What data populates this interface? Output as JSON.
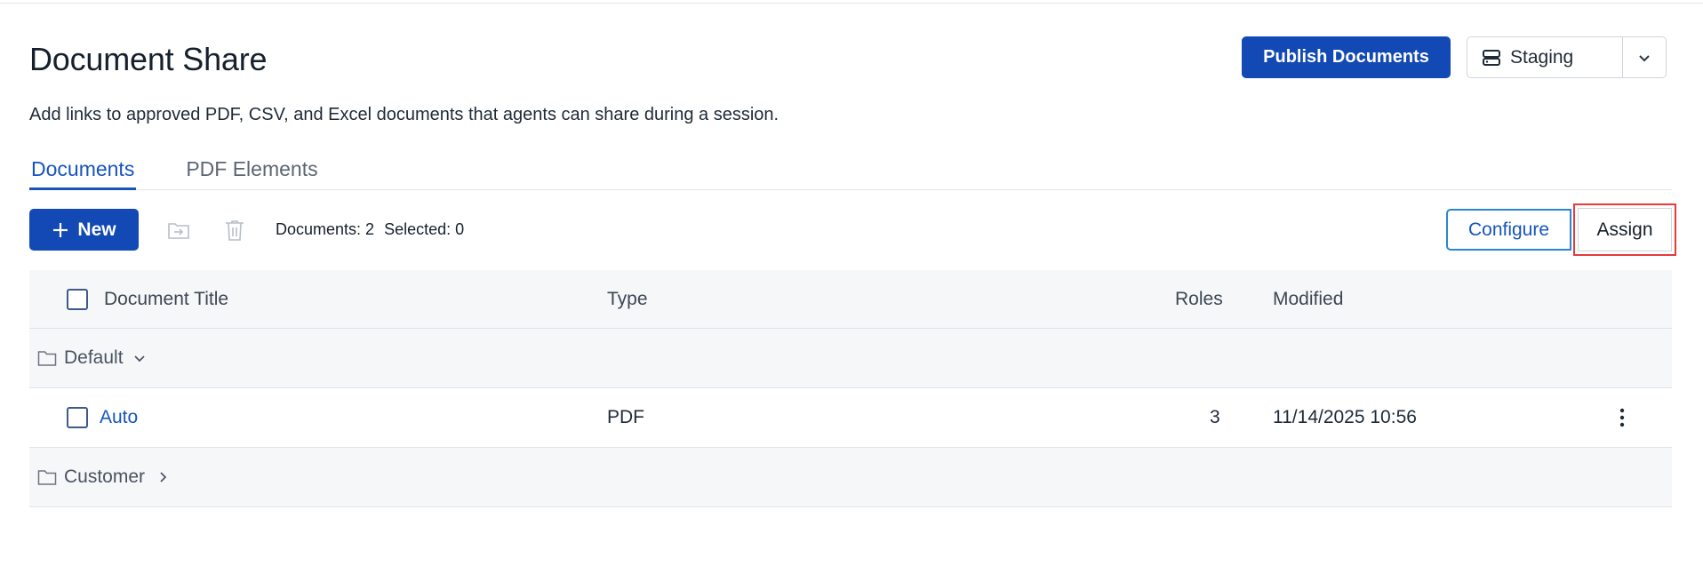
{
  "page": {
    "title": "Document Share",
    "description": "Add links to approved PDF, CSV, and Excel documents that agents can share during a session."
  },
  "header": {
    "publish_label": "Publish Documents",
    "environment": "Staging"
  },
  "tabs": [
    {
      "label": "Documents",
      "active": true
    },
    {
      "label": "PDF Elements",
      "active": false
    }
  ],
  "toolbar": {
    "new_label": "New",
    "documents_count": "Documents: 2",
    "selected_count": "Selected: 0",
    "configure_label": "Configure",
    "assign_label": "Assign"
  },
  "table": {
    "columns": {
      "title": "Document Title",
      "type": "Type",
      "roles": "Roles",
      "modified": "Modified"
    },
    "groups": [
      {
        "name": "Default",
        "expanded": true,
        "rows": [
          {
            "title": "Auto",
            "type": "PDF",
            "roles": "3",
            "modified": "11/14/2025 10:56"
          }
        ]
      },
      {
        "name": "Customer",
        "expanded": false,
        "rows": []
      }
    ]
  },
  "colors": {
    "primary": "#1249b5",
    "link": "#1655bd",
    "highlight": "#e53b3b",
    "configure_border": "#2a86d1"
  },
  "icons": {
    "environment": "server-icon",
    "env_dropdown": "chevron-down-icon",
    "new": "plus-icon",
    "move": "move-to-folder-icon",
    "delete": "trash-icon",
    "folder": "folder-icon",
    "expand": "chevron-down-icon",
    "collapse": "chevron-right-icon",
    "row_menu": "more-vertical-icon"
  }
}
